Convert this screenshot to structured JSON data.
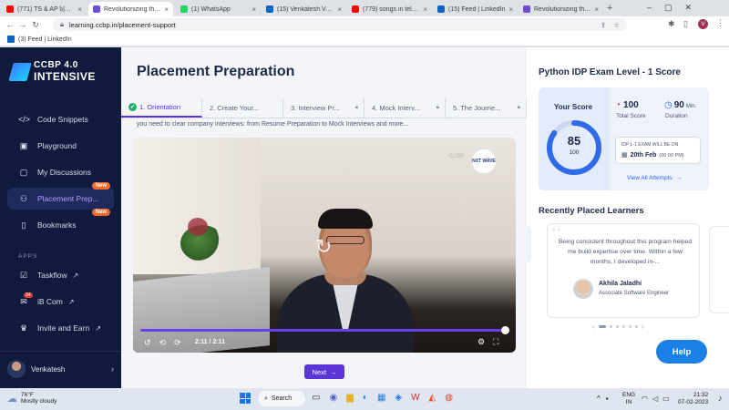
{
  "browser": {
    "tabs": [
      {
        "title": "(771) TS & AP ს|ფ||...",
        "favicon_color": "#ff0000",
        "active": false
      },
      {
        "title": "Revolutionizing the N...",
        "favicon_color": "#6b4dd6",
        "active": true
      },
      {
        "title": "(1) WhatsApp",
        "favicon_color": "#25d366",
        "active": false
      },
      {
        "title": "(15) Venkatesh Vado...",
        "favicon_color": "#0a66c2",
        "active": false
      },
      {
        "title": "(779) songs in telugu...",
        "favicon_color": "#ff0000",
        "active": false
      },
      {
        "title": "(15) Feed | LinkedIn",
        "favicon_color": "#0a66c2",
        "active": false
      },
      {
        "title": "Revolutionizing the N...",
        "favicon_color": "#6b4dd6",
        "active": false
      }
    ],
    "url": "learning.ccbp.in/placement-support",
    "bookmark": "(3) Feed | LinkedIn",
    "profile_initial": "V"
  },
  "sidebar": {
    "logo_line1": "CCBP 4.0",
    "logo_line2": "INTENSIVE",
    "items": [
      {
        "label": "Code Snippets",
        "icon": "</>"
      },
      {
        "label": "Playground",
        "icon": "▣"
      },
      {
        "label": "My Discussions",
        "icon": "▢"
      },
      {
        "label": "Placement Prep...",
        "icon": "⚇",
        "badge": "New",
        "active": true
      },
      {
        "label": "Bookmarks",
        "icon": "▯",
        "badge": "New"
      }
    ],
    "apps_heading": "APPS",
    "apps": [
      {
        "label": "Taskflow",
        "icon": "☑"
      },
      {
        "label": "iB Com",
        "icon": "✉",
        "count": "34"
      },
      {
        "label": "Invite and Earn",
        "icon": "♛"
      }
    ],
    "user": "Venkatesh"
  },
  "main": {
    "title": "Placement Preparation",
    "steps": [
      {
        "label": "1. Orientation",
        "active": true
      },
      {
        "label": "2. Create Your...",
        "active": false
      },
      {
        "label": "3. Interview Pr...",
        "active": false
      },
      {
        "label": "4. Mock Interv...",
        "active": false
      },
      {
        "label": "5. The Journe...",
        "active": false
      }
    ],
    "intro_text": "you need to clear company interviews: from Resume Preparation to Mock Interviews and more...",
    "video": {
      "watermark": "NXT WAVE",
      "corner_text": "CCBP",
      "time": "2:11 / 2:11",
      "progress": 1.0
    },
    "next_label": "Next"
  },
  "right": {
    "score_title": "Python IDP Exam Level - 1 Score",
    "your_score_label": "Your Score",
    "score": "85",
    "score_out_of": "100",
    "score_fraction": 0.85,
    "total_score_value": "100",
    "total_score_label": "Total Score",
    "duration_value": "90",
    "duration_unit": "Min.",
    "duration_label": "Duration",
    "exam_notice": "IDP L-1 EXAM WILL BE ON",
    "exam_date": "20th Feb",
    "exam_time": "(06:00 PM)",
    "view_all": "View All Attempts",
    "learners_title": "Recently Placed Learners",
    "testimonial": "Being consistent throughout this program helped me build expertise over time. Within a few months, I developed in-...",
    "learner_name": "Akhila Jaladhi",
    "learner_role": "Associate Software Engineer",
    "help_label": "Help"
  },
  "taskbar": {
    "weather_temp": "76°F",
    "weather_desc": "Mostly cloudy",
    "search_label": "Search",
    "lang_line1": "ENG",
    "lang_line2": "IN",
    "time": "21:32",
    "date": "07-02-2023"
  }
}
